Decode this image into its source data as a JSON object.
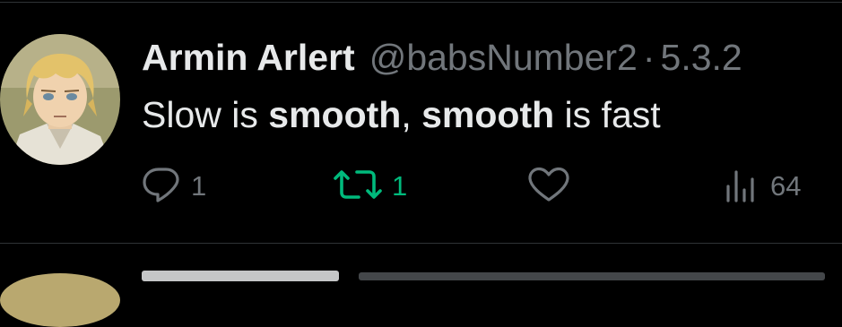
{
  "tweet": {
    "author_name": "Armin Arlert",
    "handle": "@babsNumber2",
    "separator": "·",
    "date": "5.3.2",
    "text_segments": [
      {
        "text": "Slow is ",
        "bold": false
      },
      {
        "text": "smooth",
        "bold": true
      },
      {
        "text": ", ",
        "bold": false
      },
      {
        "text": "smooth",
        "bold": true
      },
      {
        "text": " is fast",
        "bold": false
      }
    ],
    "actions": {
      "reply_count": "1",
      "retweet_count": "1",
      "like_count": "",
      "views_count": "64"
    }
  },
  "colors": {
    "background": "#000000",
    "primary_text": "#e7e9ea",
    "secondary_text": "#71767b",
    "retweet_active": "#00ba7c",
    "divider": "#2f3336"
  },
  "icons": {
    "reply": "reply-bubble-icon",
    "retweet": "retweet-arrows-icon",
    "like": "heart-outline-icon",
    "views": "bar-chart-views-icon"
  }
}
